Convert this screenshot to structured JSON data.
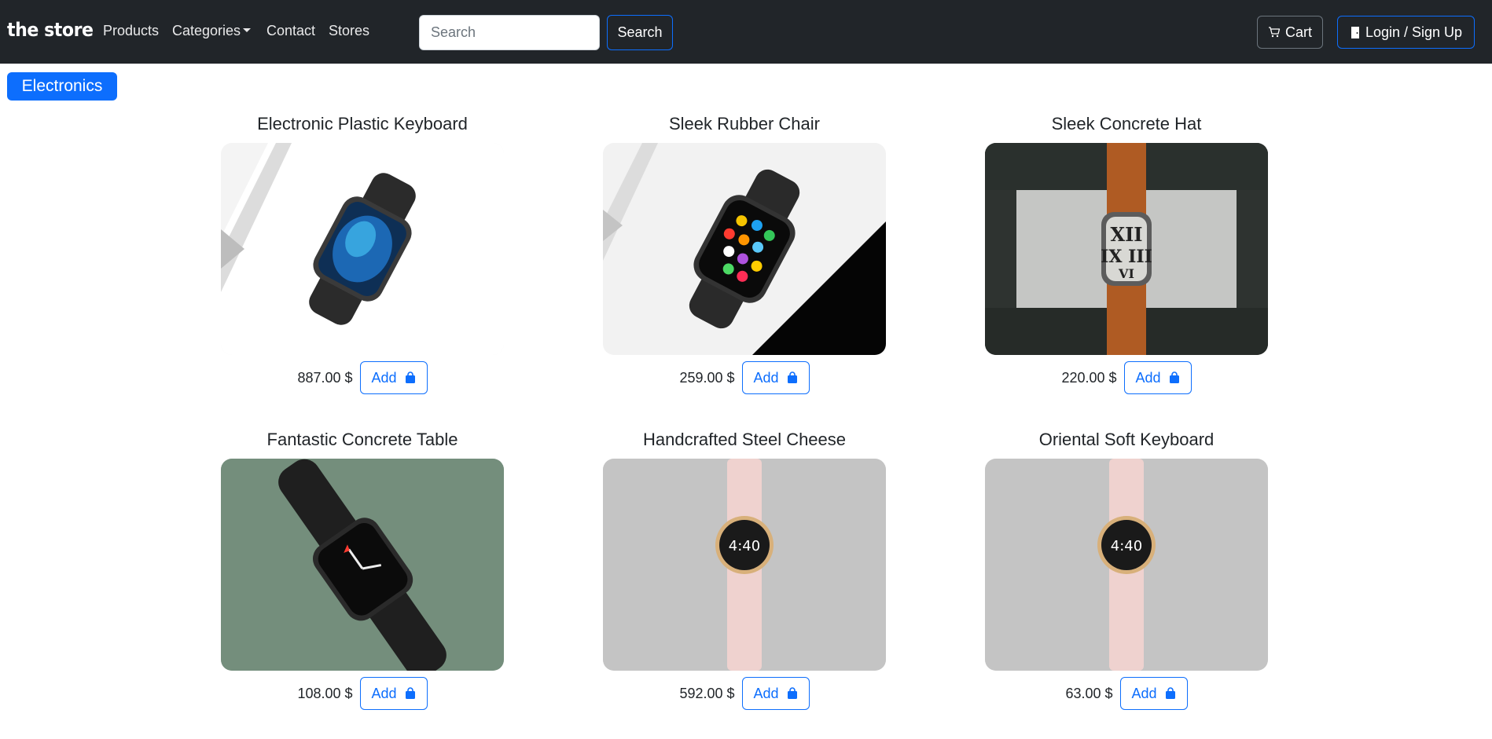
{
  "navbar": {
    "brand": "the store",
    "links": [
      "Products",
      "Categories",
      "Contact",
      "Stores"
    ],
    "search_placeholder": "Search",
    "search_button": "Search",
    "cart_label": "Cart",
    "login_label": "Login / Sign Up"
  },
  "category": {
    "label": "Electronics"
  },
  "add_label": "Add",
  "products": [
    {
      "title": "Electronic Plastic Keyboard",
      "price": "887.00 $",
      "image": "watch-blue-face-on-white"
    },
    {
      "title": "Sleek Rubber Chair",
      "price": "259.00 $",
      "image": "watch-apps-face-on-white"
    },
    {
      "title": "Sleek Concrete Hat",
      "price": "220.00 $",
      "image": "watch-orange-band-roman-face"
    },
    {
      "title": "Fantastic Concrete Table",
      "price": "108.00 $",
      "image": "watch-black-sport-band-on-green"
    },
    {
      "title": "Handcrafted Steel Cheese",
      "price": "592.00 $",
      "image": "watch-pink-band-round-face"
    },
    {
      "title": "Oriental Soft Keyboard",
      "price": "63.00 $",
      "image": "watch-pink-band-round-face"
    }
  ],
  "colors": {
    "navbar": "#212529",
    "primary": "#0d6efd"
  }
}
